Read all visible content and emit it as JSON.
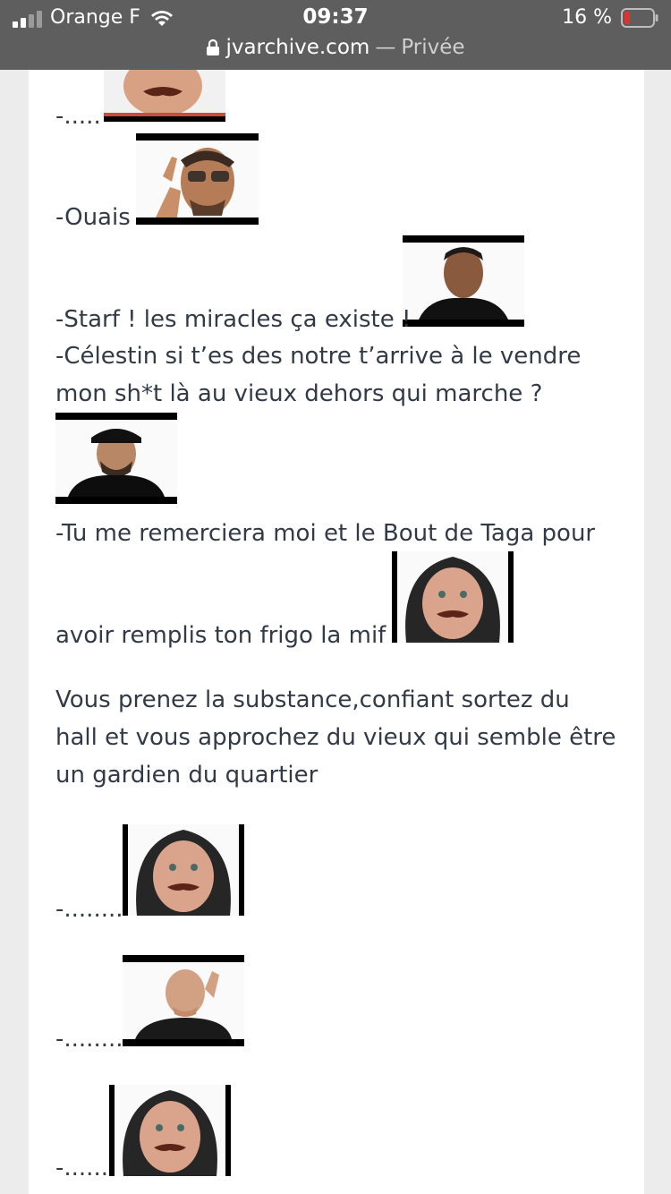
{
  "status_bar": {
    "carrier": "Orange F",
    "time": "09:37",
    "battery_percent": "16 %",
    "battery_level": 0.16,
    "signal_bars": 2
  },
  "url_bar": {
    "domain": "jvarchive.com",
    "separator": "—",
    "mode": "Privée"
  },
  "post": {
    "lines": [
      "-.....",
      "-Ouais",
      "-Starf ! les miracles ça existe !",
      "-Célestin si t’es des notre t’arrive à le vendre",
      "mon sh*t là au vieux dehors qui marche ?",
      "-Tu me remerciera moi et le Bout de Taga pour",
      "avoir remplis ton frigo la mif",
      "Vous prenez la substance,confiant sortez du",
      "hall et vous approchez du vieux qui semble être",
      "un gardien du quartier",
      "-........",
      "-........",
      "-......"
    ]
  },
  "colors": {
    "status_bg": "#5e5e5e",
    "page_bg": "#ececec",
    "card_bg": "#ffffff",
    "text": "#333a47",
    "battery_low": "#e0312b"
  }
}
